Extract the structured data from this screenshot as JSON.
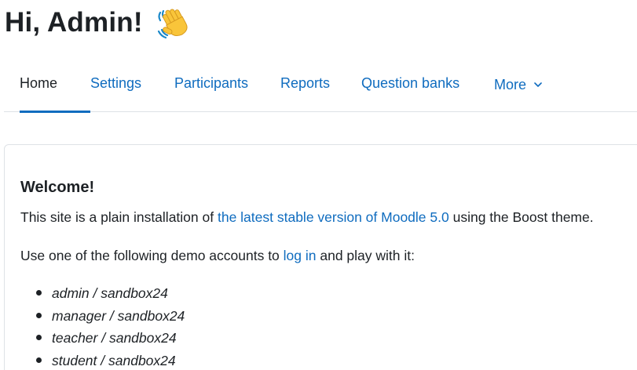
{
  "greeting": {
    "text": "Hi, Admin!",
    "icon": "waving-hand-emoji"
  },
  "nav": {
    "tabs": [
      {
        "label": "Home",
        "active": true
      },
      {
        "label": "Settings"
      },
      {
        "label": "Participants"
      },
      {
        "label": "Reports"
      },
      {
        "label": "Question banks"
      },
      {
        "label": "More"
      }
    ],
    "more_icon": "chevron-down-icon",
    "accent_color": "#0f6cbf"
  },
  "welcome": {
    "title": "Welcome!",
    "intro_before": "This site is a plain installation of ",
    "intro_link": "the latest stable version of Moodle 5.0",
    "intro_after": " using the Boost theme.",
    "accounts_before": "Use one of the following demo accounts to ",
    "accounts_link": "log in",
    "accounts_after": " and play with it:",
    "accounts": [
      "admin / sandbox24",
      "manager / sandbox24",
      "teacher / sandbox24",
      "student / sandbox24"
    ]
  }
}
